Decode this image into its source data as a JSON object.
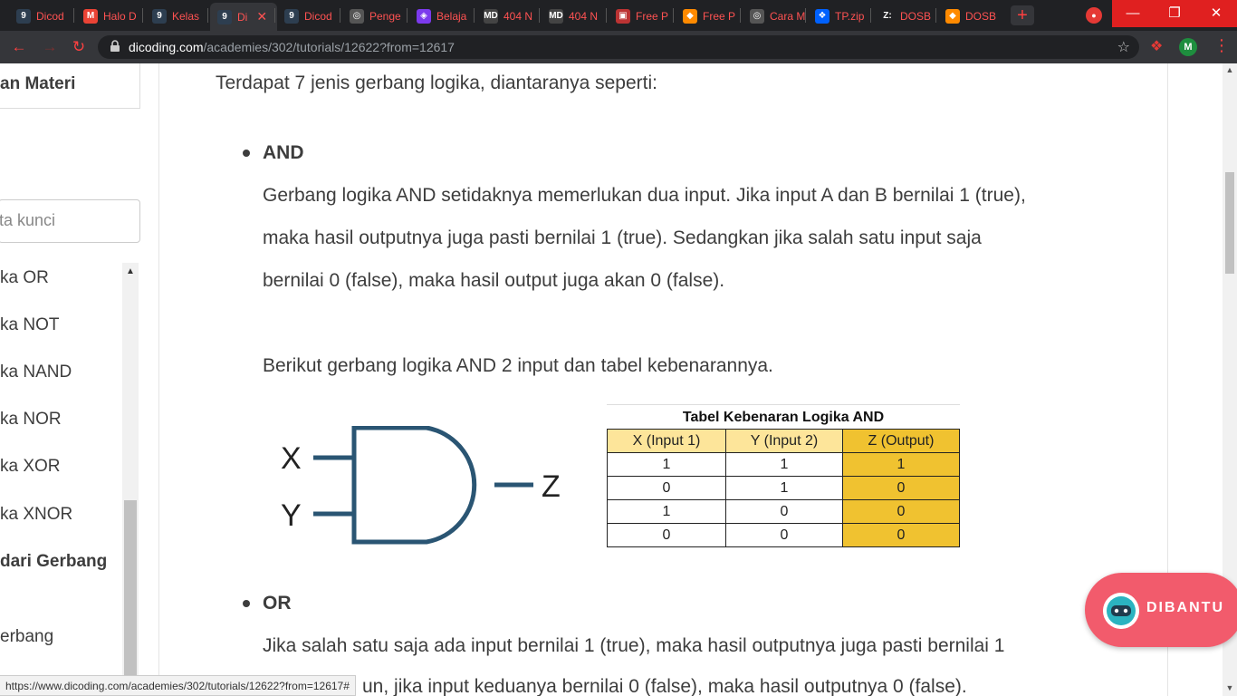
{
  "browser": {
    "tabs": [
      {
        "icon": "dicoding-icon",
        "glyph": "9",
        "label": "Dicod",
        "color": "#2d3e50"
      },
      {
        "icon": "gmail-icon",
        "glyph": "M",
        "label": "Halo D",
        "color": "#ea4335"
      },
      {
        "icon": "dicoding-icon",
        "glyph": "9",
        "label": "Kelas",
        "color": "#2d3e50"
      },
      {
        "icon": "dicoding-icon",
        "glyph": "9",
        "label": "Di",
        "color": "#2d3e50",
        "active": true
      },
      {
        "icon": "dicoding-icon",
        "glyph": "9",
        "label": "Dicod",
        "color": "#2d3e50"
      },
      {
        "icon": "globe-icon",
        "glyph": "◎",
        "label": "Penge",
        "color": "#555"
      },
      {
        "icon": "laravel-icon",
        "glyph": "◈",
        "label": "Belaja",
        "color": "#7c3aed"
      },
      {
        "icon": "markdown-icon",
        "glyph": "MD",
        "label": "404 N",
        "color": "#444"
      },
      {
        "icon": "markdown-icon",
        "glyph": "MD",
        "label": "404 N",
        "color": "#444"
      },
      {
        "icon": "image-icon",
        "glyph": "▣",
        "label": "Free P",
        "color": "#b33"
      },
      {
        "icon": "freepik-icon",
        "glyph": "◆",
        "label": "Free P",
        "color": "#ff8a00"
      },
      {
        "icon": "globe-icon",
        "glyph": "◎",
        "label": "Cara M",
        "color": "#555"
      },
      {
        "icon": "dropbox-icon",
        "glyph": "❖",
        "label": "TP.zip",
        "color": "#0061fe"
      },
      {
        "icon": "zenodo-icon",
        "glyph": "Z:",
        "label": "DOSB",
        "color": "#202124"
      },
      {
        "icon": "freepik-icon",
        "glyph": "◆",
        "label": "DOSB",
        "color": "#ff8a00"
      }
    ],
    "url_host": "dicoding.com",
    "url_path": "/academies/302/tutorials/12622?from=12617",
    "avatar_letter": "M",
    "status_url": "https://www.dicoding.com/academies/302/tutorials/12622?from=12617#"
  },
  "sidebar": {
    "header": "an Materi",
    "search_placeholder": "ta kunci",
    "items": [
      {
        "label": "ka OR",
        "bold": false
      },
      {
        "label": "ka NOT",
        "bold": false
      },
      {
        "label": "ka NAND",
        "bold": false
      },
      {
        "label": "ka NOR",
        "bold": false
      },
      {
        "label": "ka XOR",
        "bold": false
      },
      {
        "label": "ka XNOR",
        "bold": false
      },
      {
        "label": "dari Gerbang",
        "bold": true
      },
      {
        "label": "erbang",
        "bold": false
      }
    ]
  },
  "content": {
    "intro": "Terdapat 7 jenis gerbang logika, diantaranya seperti:",
    "and_heading": "AND",
    "and_p1": "Gerbang logika AND setidaknya memerlukan dua input. Jika input A dan B bernilai 1 (true),",
    "and_p2": "maka hasil outputnya juga pasti bernilai 1 (true). Sedangkan jika salah satu input saja",
    "and_p3": "bernilai 0 (false), maka hasil output juga akan 0 (false).",
    "and_caption": "Berikut gerbang logika AND 2 input dan tabel kebenarannya.",
    "gate": {
      "in_x": "X",
      "in_y": "Y",
      "out_z": "Z"
    },
    "table": {
      "title": "Tabel Kebenaran Logika AND",
      "headers": [
        "X (Input 1)",
        "Y (Input 2)",
        "Z (Output)"
      ],
      "rows": [
        [
          "1",
          "1",
          "1"
        ],
        [
          "0",
          "1",
          "0"
        ],
        [
          "1",
          "0",
          "0"
        ],
        [
          "0",
          "0",
          "0"
        ]
      ]
    },
    "or_heading": "OR",
    "or_p1": "Jika salah satu saja ada input bernilai 1 (true), maka hasil outputnya juga pasti bernilai 1",
    "or_p2": "un, jika input keduanya bernilai 0 (false), maka hasil outputnya 0 (false)."
  },
  "help_button": {
    "label": "DIBANTU"
  },
  "colors": {
    "accent": "#f25b6c",
    "gate_stroke": "#2a5573",
    "table_output": "#f0c230",
    "table_header": "#fde59a"
  }
}
